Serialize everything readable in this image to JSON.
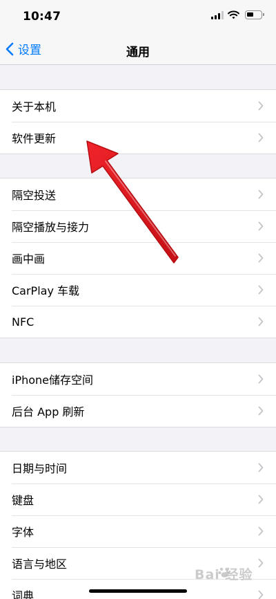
{
  "status_bar": {
    "time": "10:47"
  },
  "nav": {
    "back_label": "设置",
    "title": "通用"
  },
  "groups": [
    {
      "items": [
        {
          "label": "关于本机"
        },
        {
          "label": "软件更新"
        }
      ]
    },
    {
      "items": [
        {
          "label": "隔空投送"
        },
        {
          "label": "隔空播放与接力"
        },
        {
          "label": "画中画"
        },
        {
          "label": "CarPlay 车载"
        },
        {
          "label": "NFC"
        }
      ]
    },
    {
      "items": [
        {
          "label": "iPhone储存空间"
        },
        {
          "label": "后台 App 刷新"
        }
      ]
    },
    {
      "items": [
        {
          "label": "日期与时间"
        },
        {
          "label": "键盘"
        },
        {
          "label": "字体"
        },
        {
          "label": "语言与地区"
        },
        {
          "label": "词典"
        }
      ]
    }
  ],
  "watermark": {
    "text": "Bai  经验"
  },
  "icons": {
    "back": "chevron-left-icon",
    "row_disclosure": "chevron-right-icon",
    "annotation": "red-arrow"
  },
  "colors": {
    "accent": "#007aff",
    "annotation": "#e3141b",
    "background": "#f2f2f7"
  }
}
